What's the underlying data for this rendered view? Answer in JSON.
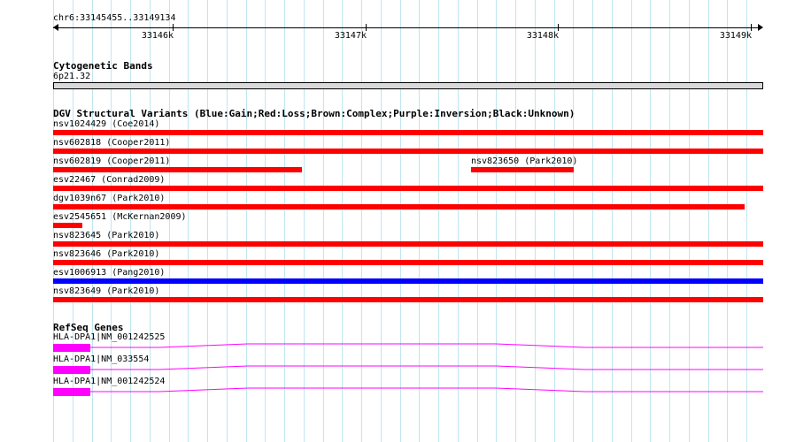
{
  "ruler": {
    "region": "chr6:33145455..33149134",
    "ticks": [
      {
        "label": "33146k"
      },
      {
        "label": "33147k"
      },
      {
        "label": "33148k"
      },
      {
        "label": "33149k"
      }
    ]
  },
  "cytoband": {
    "title": "Cytogenetic Bands",
    "band_label": "6p21.32",
    "band_color": "#d9d9d9"
  },
  "dgv": {
    "title": "DGV Structural Variants (Blue:Gain;Red:Loss;Brown:Complex;Purple:Inversion;Black:Unknown)",
    "colors": {
      "gain": "#0000ff",
      "loss": "#ff0000"
    },
    "features": [
      {
        "label": "nsv1024429 (Coe2014)",
        "type": "loss"
      },
      {
        "label": "nsv602818 (Cooper2011)",
        "type": "loss"
      },
      {
        "label": "nsv602819 (Cooper2011)",
        "type": "loss"
      },
      {
        "label": "nsv823650 (Park2010)",
        "type": "loss"
      },
      {
        "label": "esv22467 (Conrad2009)",
        "type": "loss"
      },
      {
        "label": "dgv1039n67 (Park2010)",
        "type": "loss"
      },
      {
        "label": "esv2545651 (McKernan2009)",
        "type": "loss"
      },
      {
        "label": "nsv823645 (Park2010)",
        "type": "loss"
      },
      {
        "label": "nsv823646 (Park2010)",
        "type": "loss"
      },
      {
        "label": "esv1006913 (Pang2010)",
        "type": "gain"
      },
      {
        "label": "nsv823649 (Park2010)",
        "type": "loss"
      }
    ]
  },
  "refseq": {
    "title": "RefSeq Genes",
    "color": "#ff00ff",
    "genes": [
      {
        "label": "HLA-DPA1|NM_001242525"
      },
      {
        "label": "HLA-DPA1|NM_033554"
      },
      {
        "label": "HLA-DPA1|NM_001242524"
      }
    ]
  }
}
